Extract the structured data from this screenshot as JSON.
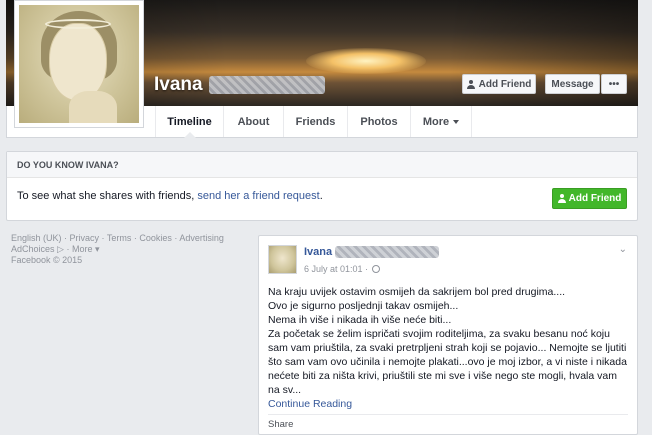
{
  "profile": {
    "name": "Ivana",
    "surname_redacted": true
  },
  "cover_buttons": {
    "add_friend": "Add Friend",
    "message": "Message",
    "more": "•••"
  },
  "tabs": [
    {
      "label": "Timeline",
      "active": true
    },
    {
      "label": "About"
    },
    {
      "label": "Friends"
    },
    {
      "label": "Photos"
    },
    {
      "label": "More"
    }
  ],
  "know_card": {
    "heading": "DO YOU KNOW IVANA?",
    "text": "To see what she shares with friends, ",
    "link": "send her a friend request",
    "text_end": ".",
    "button": "Add Friend"
  },
  "footer": {
    "line1": "English (UK) · Privacy · Terms · Cookies · Advertising",
    "line2": "AdChoices ▷ · More ▾",
    "line3": "Facebook © 2015"
  },
  "post": {
    "author": "Ivana",
    "timestamp": "6 July at 01:01 ·",
    "lines": [
      "Na kraju uvijek ostavim osmijeh da sakrijem bol pred drugima....",
      "Ovo je sigurno posljednji takav osmijeh...",
      "Nema ih više i nikada ih više neće biti...",
      "Za početak se želim ispričati svojim roditeljima, za svaku besanu noć koju sam vam priuštila, za svaki pretrpljeni strah koji se pojavio... Nemojte se ljutiti što sam vam ovo učinila i nemojte plakati...ovo je moj izbor, a vi niste i nikada nećete biti za ništa krivi, priuštili ste mi sve i više nego ste mogli, hvala vam na sv..."
    ],
    "continue": "Continue Reading",
    "share": "Share"
  },
  "colors": {
    "link": "#365899",
    "green_button": "#42b72a",
    "page_bg": "#e9ebee"
  }
}
